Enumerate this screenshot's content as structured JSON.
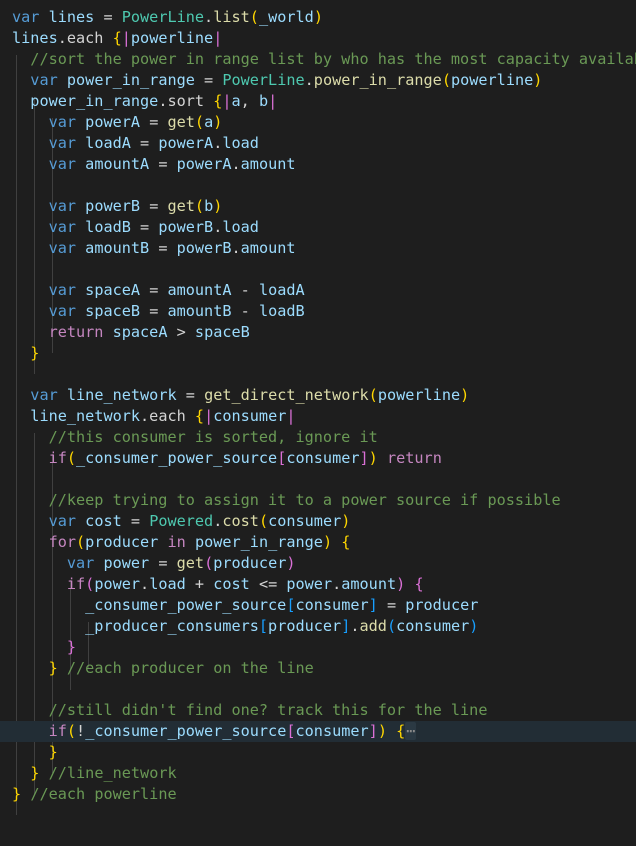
{
  "editor": {
    "theme": "dark-plus",
    "background_color": "#1e1e1e",
    "highlight_line_color": "#222d35",
    "indent_guide_color": "#404040",
    "font_size_px": 15,
    "line_height_px": 21,
    "highlighted_line_number": 36,
    "colors": {
      "keyword": "#569cd6",
      "control": "#c586c0",
      "class": "#4ec9b0",
      "function": "#dcdcaa",
      "variable": "#9cdcfe",
      "comment": "#6a9955",
      "plain": "#d4d4d4",
      "bracket_1": "#ffd700",
      "bracket_2": "#da70d6",
      "bracket_3": "#179fff",
      "fold_placeholder": "#8a8a8a"
    },
    "fold_placeholder_glyph": "⋯"
  },
  "code": {
    "language": "mirah",
    "lines": [
      "var lines = PowerLine.list(_world)",
      "lines.each {|powerline|",
      "  //sort the power in range list by who has the most capacity available",
      "  var power_in_range = PowerLine.power_in_range(powerline)",
      "  power_in_range.sort {|a, b|",
      "    var powerA = get(a)",
      "    var loadA = powerA.load",
      "    var amountA = powerA.amount",
      "",
      "    var powerB = get(b)",
      "    var loadB = powerB.load",
      "    var amountB = powerB.amount",
      "",
      "    var spaceA = amountA - loadA",
      "    var spaceB = amountB - loadB",
      "    return spaceA > spaceB",
      "  }",
      "",
      "  var line_network = get_direct_network(powerline)",
      "  line_network.each {|consumer|",
      "    //this consumer is sorted, ignore it",
      "    if(_consumer_power_source[consumer]) return",
      "",
      "    //keep trying to assign it to a power source if possible",
      "    var cost = Powered.cost(consumer)",
      "    for(producer in power_in_range) {",
      "      var power = get(producer)",
      "      if(power.load + cost <= power.amount) {",
      "        _consumer_power_source[consumer] = producer",
      "        _producer_consumers[producer].add(consumer)",
      "      }",
      "    } //each producer on the line",
      "",
      "    //still didn't find one? track this for the line",
      "    if(!_consumer_power_source[consumer]) {",
      "    }",
      "  } //line_network",
      "} //each powerline"
    ]
  }
}
